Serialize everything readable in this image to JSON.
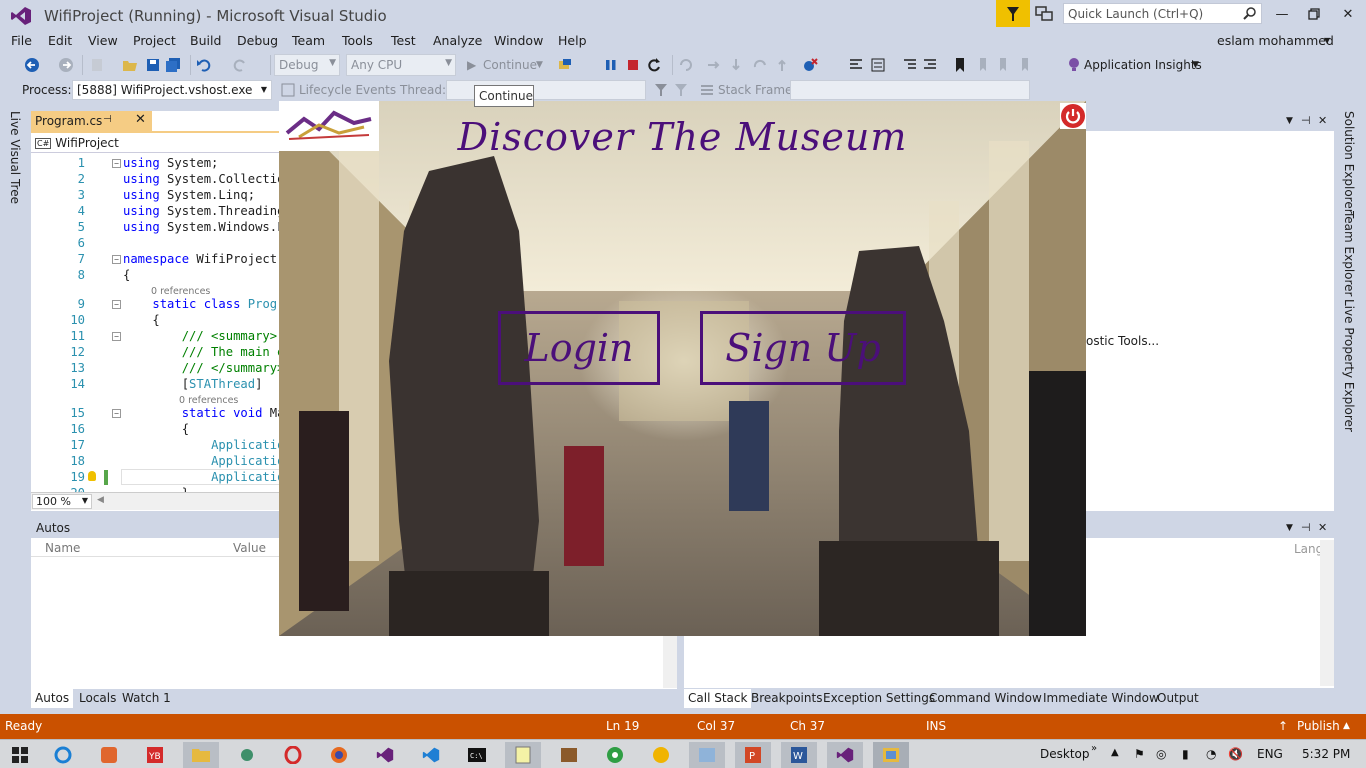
{
  "window": {
    "title": "WifiProject (Running) - Microsoft Visual Studio",
    "quick_launch_placeholder": "Quick Launch (Ctrl+Q)",
    "user": "eslam mohammed"
  },
  "menu": [
    "File",
    "Edit",
    "View",
    "Project",
    "Build",
    "Debug",
    "Team",
    "Tools",
    "Test",
    "Analyze",
    "Window",
    "Help"
  ],
  "toolbar": {
    "config": "Debug",
    "platform": "Any CPU",
    "continue_label": "Continue",
    "app_insights": "Application Insights"
  },
  "debugbar": {
    "process_label": "Process:",
    "process_value": "[5888] WifiProject.vshost.exe",
    "lifecycle": "Lifecycle Events",
    "thread_label": "Thread:",
    "stack_frame_label": "Stack Frame:",
    "tooltip": "Continue"
  },
  "left_strip": {
    "live_visual_tree": "Live Visual Tree"
  },
  "right_strip": {
    "solution_explorer": "Solution Explorer",
    "team_explorer": "Team Explorer",
    "live_property_explorer": "Live Property Explorer"
  },
  "editor": {
    "tab_name": "Program.cs",
    "nav_scope": "WifiProject",
    "zoom": "100 %",
    "lines": [
      {
        "n": "1",
        "html": "<span class='kw'>using</span> System;"
      },
      {
        "n": "2",
        "html": "<span class='kw'>using</span> System.Collection"
      },
      {
        "n": "3",
        "html": "<span class='kw'>using</span> System.Linq;"
      },
      {
        "n": "4",
        "html": "<span class='kw'>using</span> System.Threading"
      },
      {
        "n": "5",
        "html": "<span class='kw'>using</span> System.Windows.Fo"
      },
      {
        "n": "6",
        "html": ""
      },
      {
        "n": "7",
        "html": "<span class='kw'>namespace</span> WifiProject"
      },
      {
        "n": "8",
        "html": "{"
      },
      {
        "n": "9",
        "html": "    <span class='kw'>static class</span> <span class='ty'>Progra</span>"
      },
      {
        "n": "10",
        "html": "    {"
      },
      {
        "n": "11",
        "html": "        <span class='cm'>/// &lt;summary&gt;</span>"
      },
      {
        "n": "12",
        "html": "        <span class='cm'>/// The main e</span>"
      },
      {
        "n": "13",
        "html": "        <span class='cm'>/// &lt;/summary&gt;</span>"
      },
      {
        "n": "14",
        "html": "        [<span class='ty'>STAThread</span>]"
      },
      {
        "n": "15",
        "html": "        <span class='kw'>static void</span> Ma"
      },
      {
        "n": "16",
        "html": "        {"
      },
      {
        "n": "17",
        "html": "            <span class='ty'>Application</span>"
      },
      {
        "n": "18",
        "html": "            <span class='ty'>Application</span>"
      },
      {
        "n": "19",
        "html": "            <span class='ty'>Application</span>"
      },
      {
        "n": "20",
        "html": "        }"
      }
    ],
    "references": "0 references"
  },
  "right_panel": {
    "diag_text": "ostic Tools..."
  },
  "autos": {
    "title": "Autos",
    "col_name": "Name",
    "col_value": "Value",
    "tabs": [
      "Autos",
      "Locals",
      "Watch 1"
    ]
  },
  "callstack": {
    "col_lang": "Lang",
    "tabs": [
      "Call Stack",
      "Breakpoints",
      "Exception Settings",
      "Command Window",
      "Immediate Window",
      "Output"
    ]
  },
  "app": {
    "title": "Discover The Museum",
    "login": "Login",
    "signup": "Sign Up"
  },
  "statusbar": {
    "ready": "Ready",
    "ln": "Ln 19",
    "col": "Col 37",
    "ch": "Ch 37",
    "ins": "INS",
    "publish": "Publish"
  },
  "taskbar": {
    "desktop": "Desktop",
    "lang": "ENG",
    "time": "5:32 PM"
  },
  "colors": {
    "accent_status": "#ca5100",
    "app_purple": "#4b0f7a",
    "tab_gold": "#f5cc84"
  }
}
